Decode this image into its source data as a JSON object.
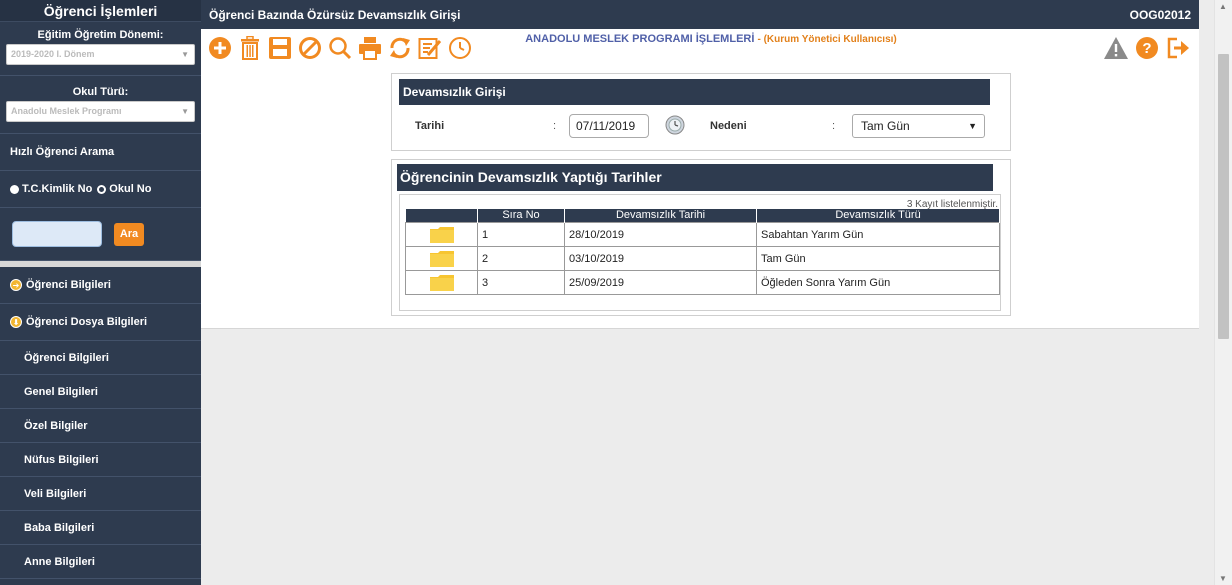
{
  "sidebar": {
    "title": "Öğrenci İşlemleri",
    "term_label": "Eğitim Öğretim Dönemi:",
    "term_value": "2019-2020 I. Dönem",
    "school_label": "Okul Türü:",
    "school_value": "Anadolu Meslek Programı",
    "quick_search": "Hızlı Öğrenci Arama",
    "radio_tc": "T.C.Kimlik No",
    "radio_okul": "Okul No",
    "search_button": "Ara",
    "menu": [
      "Öğrenci Bilgileri",
      "Öğrenci Dosya Bilgileri"
    ],
    "submenu": [
      "Öğrenci Bilgileri",
      "Genel Bilgileri",
      "Özel Bilgiler",
      "Nüfus Bilgileri",
      "Veli Bilgileri",
      "Baba Bilgileri",
      "Anne Bilgileri"
    ]
  },
  "header": {
    "title": "Öğrenci Bazında Özürsüz Devamsızlık Girişi",
    "code": "OOG02012"
  },
  "toolbar": {
    "program_title": "ANADOLU MESLEK PROGRAMI İŞLEMLERİ",
    "user_role": "- (Kurum Yönetici Kullanıcısı)",
    "icons": [
      "add-icon",
      "delete-icon",
      "save-icon",
      "cancel-icon",
      "search-icon",
      "print-icon",
      "refresh-icon",
      "edit-icon",
      "clock-icon"
    ],
    "right_icons": [
      "warning-icon",
      "help-icon",
      "exit-icon"
    ],
    "accent": "#f18a21"
  },
  "entry": {
    "title": "Devamsızlık Girişi",
    "date_label": "Tarihi",
    "date_value": "07/11/2019",
    "reason_label": "Nedeni",
    "reason_value": "Tam Gün",
    "colon": ":"
  },
  "list": {
    "title": "Öğrencinin Devamsızlık Yaptığı Tarihler",
    "count_text": "3 Kayıt listelenmiştir.",
    "columns": [
      "",
      "Sıra No",
      "Devamsızlık Tarihi",
      "Devamsızlık Türü"
    ],
    "rows": [
      {
        "no": "1",
        "date": "28/10/2019",
        "type": "Sabahtan Yarım Gün"
      },
      {
        "no": "2",
        "date": "03/10/2019",
        "type": "Tam Gün"
      },
      {
        "no": "3",
        "date": "25/09/2019",
        "type": "Öğleden Sonra Yarım Gün"
      }
    ]
  }
}
